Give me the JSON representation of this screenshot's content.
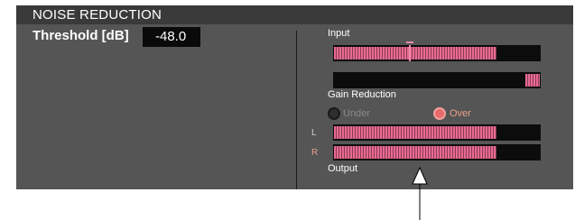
{
  "panel": {
    "title": "NOISE REDUCTION",
    "threshold": {
      "label": "Threshold [dB]",
      "value": "-48.0"
    }
  },
  "meters": {
    "input_label": "Input",
    "input_level": 0.79,
    "input_peak": 0.37,
    "gain_reduction_label": "Gain Reduction",
    "gain_reduction_level": 0.07,
    "under_label": "Under",
    "over_label": "Over",
    "output_label": "Output",
    "output": [
      {
        "channel": "L",
        "level": 0.79
      },
      {
        "channel": "R",
        "level": 0.79
      }
    ]
  },
  "colors": {
    "meter_fill": "#e86a93",
    "led_over": "#e86a6a",
    "led_under": "#3a3a3a",
    "ch_l": "#cfcfcf",
    "ch_r": "#e8a08a"
  }
}
